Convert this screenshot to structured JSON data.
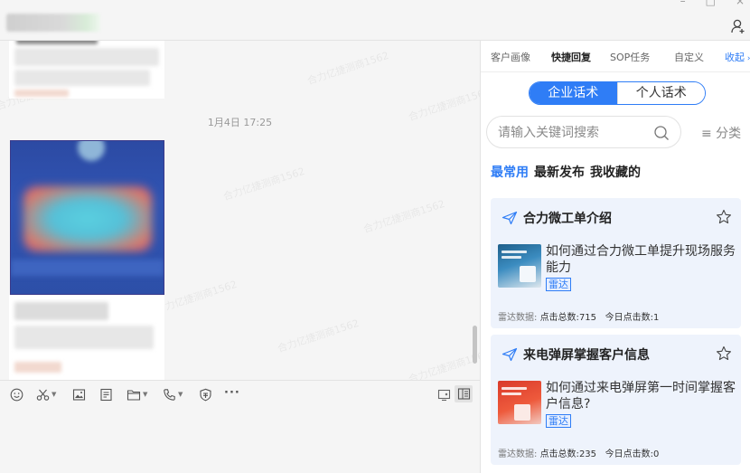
{
  "window": {
    "controls": [
      "–",
      "□",
      "×"
    ]
  },
  "chat": {
    "time_divider": "1月4日 17:25",
    "watermark_text": "合力亿捷测商1562"
  },
  "toolbar": {
    "icons": [
      "emoji-icon",
      "scissors-icon",
      "image-icon",
      "document-icon",
      "folder-icon",
      "phone-icon",
      "shield-icon",
      "more-icon",
      "screen-icon",
      "panel-toggle-icon"
    ],
    "more_label": "···"
  },
  "right_panel": {
    "tabs": [
      {
        "label": "客户画像"
      },
      {
        "label": "快捷回复"
      },
      {
        "label": "SOP任务"
      },
      {
        "label": "自定义"
      },
      {
        "label": "收起"
      }
    ],
    "segment": {
      "enterprise": "企业话术",
      "personal": "个人话术"
    },
    "search": {
      "placeholder": "请输入关键词搜索"
    },
    "category": "≡ 分类",
    "filters": [
      "最常用",
      "最新发布",
      "我收藏的"
    ],
    "cards": [
      {
        "title": "合力微工单介绍",
        "description": "如何通过合力微工单提升现场服务能力",
        "tag": "雷达",
        "stats_label": "雷达数据:",
        "total_label": "点击总数:",
        "total": "715",
        "today_label": "今日点击数:",
        "today": "1"
      },
      {
        "title": "来电弹屏掌握客户信息",
        "description": "如何通过来电弹屏第一时间掌握客户信息?",
        "tag": "雷达",
        "stats_label": "雷达数据:",
        "total_label": "点击总数:",
        "total": "235",
        "today_label": "今日点击数:",
        "today": "0"
      }
    ]
  },
  "colors": {
    "accent": "#2f7df6",
    "card_bg": "#eef3fc"
  }
}
